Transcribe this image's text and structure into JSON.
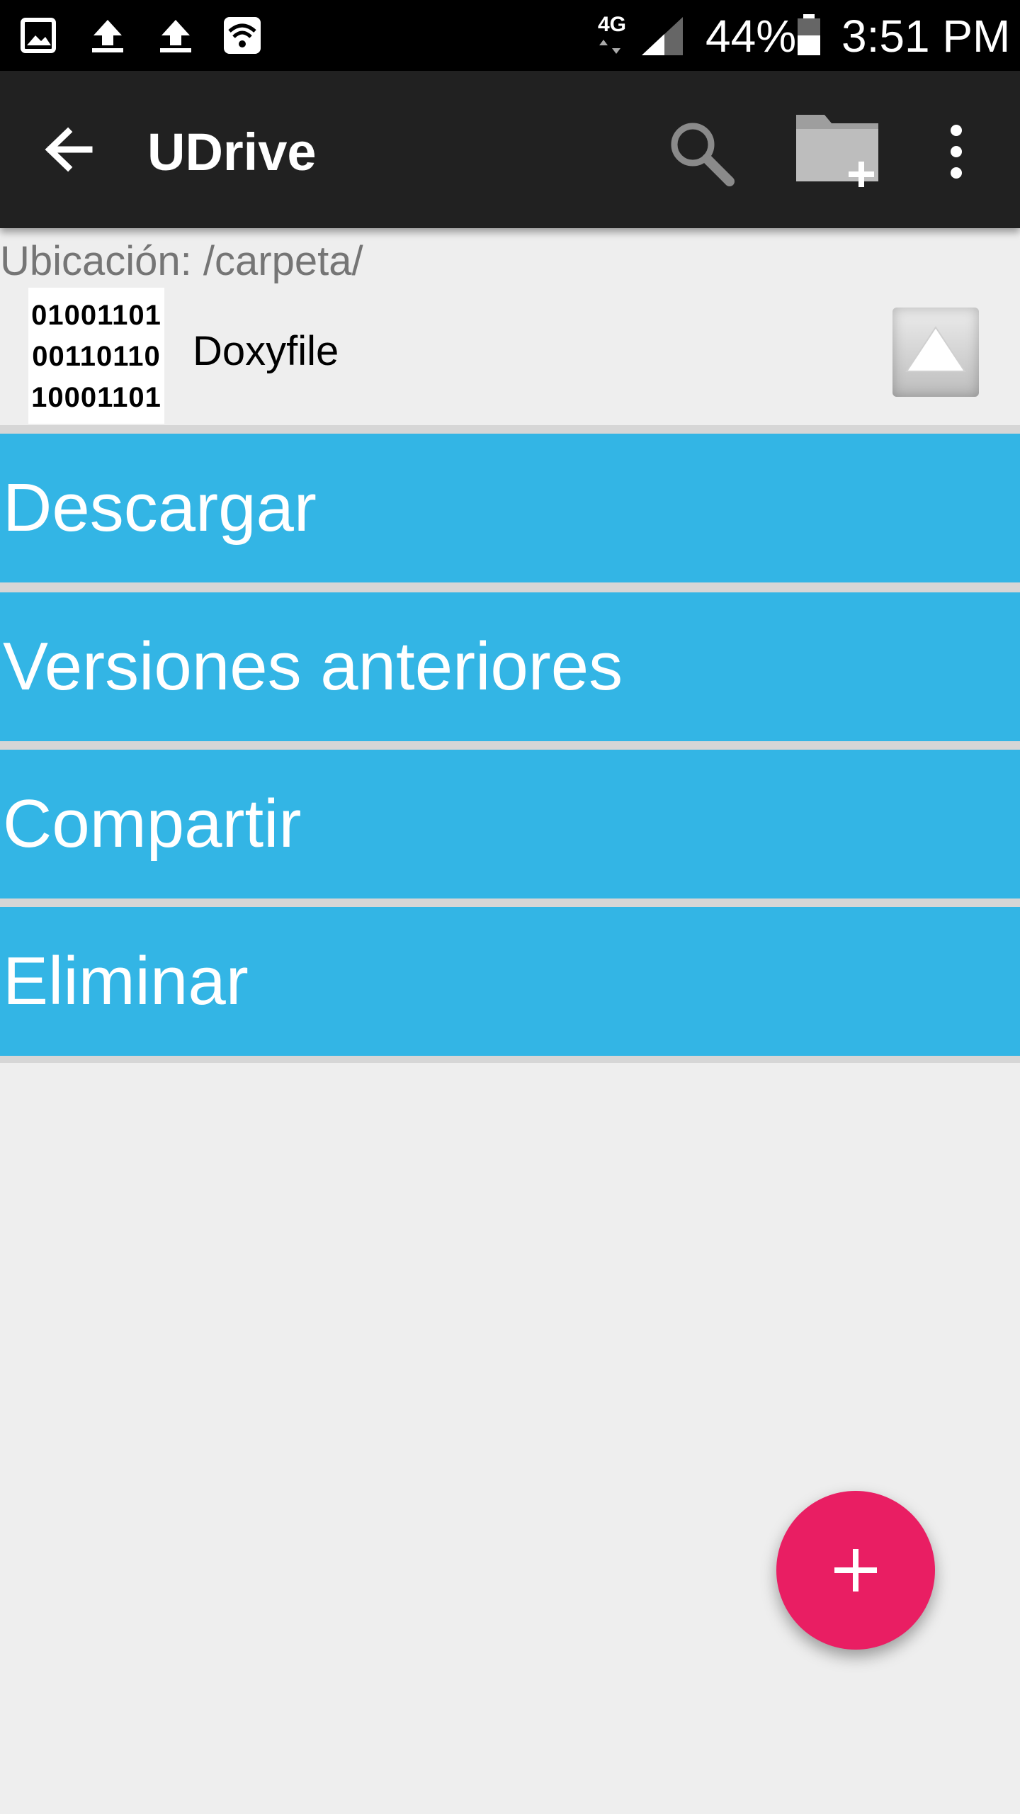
{
  "status_bar": {
    "network": "4G",
    "battery": "44%",
    "time": "3:51 PM",
    "icons": [
      "image-icon",
      "upload-icon",
      "upload-icon",
      "wifi-icon",
      "signal-icon",
      "battery-icon"
    ]
  },
  "toolbar": {
    "title": "UDrive",
    "icons": [
      "back-arrow-icon",
      "search-icon",
      "new-folder-icon",
      "overflow-menu-icon"
    ]
  },
  "location": {
    "text": "Ubicación: /carpeta/"
  },
  "file": {
    "name": "Doxyfile",
    "thumbnail_lines": [
      "01001101",
      "00110110",
      "10001101"
    ]
  },
  "actions": [
    "Descargar",
    "Versiones anteriores",
    "Compartir",
    "Eliminar"
  ],
  "fab": {
    "icon": "plus-icon"
  },
  "colors": {
    "action_blue": "#33b5e5",
    "fab_pink": "#e91e63",
    "toolbar": "#212121",
    "background": "#eeeeee"
  }
}
